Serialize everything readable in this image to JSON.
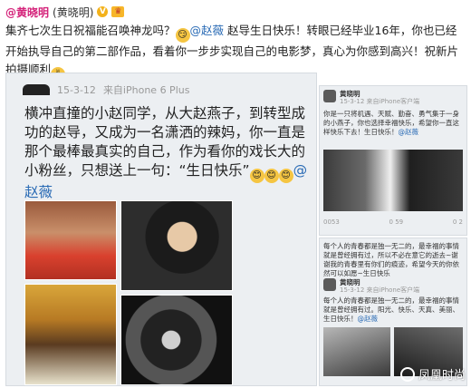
{
  "header": {
    "user": "@黄晓明",
    "paren": "(黄晓明)"
  },
  "post": {
    "part1": "集齐七次生日祝福能召唤神龙吗？",
    "mention": "@赵薇",
    "part2": " 赵导生日快乐！转眼已经毕业16年，你也已经开始执导自己的第二部作品，看着你一步步实现自己的电影梦，真心为你感到高兴！祝新片拍摄顺利"
  },
  "card_left": {
    "time": "15-3-12",
    "source": "来自iPhone 6 Plus",
    "text": "横冲直撞的小赵同学，从大赵燕子，到转型成功的赵导，又成为一名潇洒的辣妈，你一直是那个最棒最真实的自己，作为看你的戏长大的小粉丝，只想送上一句：“生日快乐”",
    "mention": "@赵薇"
  },
  "card_right_top": {
    "name": "黄晓明",
    "time": "15-3-12  来自iPhone客户端",
    "text": "你是一只将机遇、天赋、勤奋、勇气集于一身的小燕子，你也选择幸福快乐，希望你一直这样快乐下去！生日快乐！",
    "mention": "@赵薇",
    "stats": [
      "0053",
      "0 59",
      "0 2"
    ]
  },
  "card_right_bottom": {
    "text": "每个人的青春都是独一无二的，最幸福的事情就是曾经拥有过，所以不必在意它的逝去~谢谢我的青春里有你们的痕迹，希望今天的你依然可以如愿~生日快乐",
    "name": "黄晓明",
    "time": "15-3-12  来自iPhone客户端",
    "text2": "每个人的青春都是独一无二的，最幸福的事情就是曾经拥有过。阳光、快乐、天真、美丽、生日快乐！",
    "mention": "@赵薇"
  },
  "watermark": "凤凰时尚"
}
